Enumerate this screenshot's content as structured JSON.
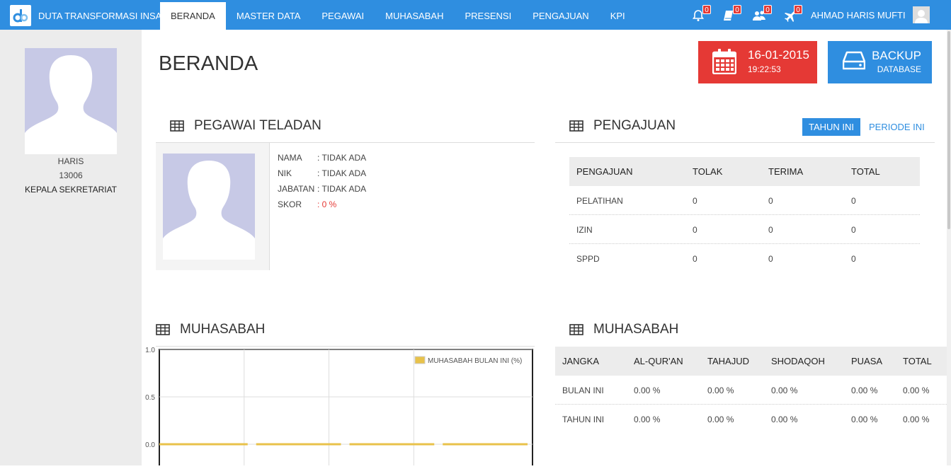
{
  "app": {
    "brand": "DUTA TRANSFORMASI INSANI"
  },
  "nav": {
    "items": [
      "BERANDA",
      "MASTER DATA",
      "PEGAWAI",
      "MUHASABAH",
      "PRESENSI",
      "PENGAJUAN",
      "KPI"
    ],
    "active": "BERANDA"
  },
  "notifications": [
    {
      "icon": "bell-icon",
      "count": "0"
    },
    {
      "icon": "book-icon",
      "count": "0"
    },
    {
      "icon": "users-icon",
      "count": "0"
    },
    {
      "icon": "plane-icon",
      "count": "0"
    }
  ],
  "user": {
    "name": "AHMAD HARIS MUFTI"
  },
  "sidebar": {
    "name": "HARIS",
    "nik": "13006",
    "role": "KEPALA SEKRETARIAT"
  },
  "page": {
    "title": "BERANDA"
  },
  "datetime": {
    "date": "16-01-2015",
    "time": "19:22:53"
  },
  "backup": {
    "title": "BACKUP",
    "subtitle": "DATABASE"
  },
  "teladan": {
    "title": "PEGAWAI TELADAN",
    "fields": [
      {
        "label": "NAMA",
        "value": ": TIDAK ADA"
      },
      {
        "label": "NIK",
        "value": ": TIDAK ADA"
      },
      {
        "label": "JABATAN",
        "value": ": TIDAK ADA"
      },
      {
        "label": "SKOR",
        "value": ": 0 %"
      }
    ],
    "score_color": "#e53935"
  },
  "pengajuan": {
    "title": "PENGAJUAN",
    "tabs": [
      "TAHUN INI",
      "PERIODE INI"
    ],
    "active_tab": "TAHUN INI",
    "columns": [
      "PENGAJUAN",
      "TOLAK",
      "TERIMA",
      "TOTAL"
    ],
    "rows": [
      [
        "PELATIHAN",
        "0",
        "0",
        "0"
      ],
      [
        "IZIN",
        "0",
        "0",
        "0"
      ],
      [
        "SPPD",
        "0",
        "0",
        "0"
      ]
    ]
  },
  "muhasabah_chart": {
    "title": "MUHASABAH"
  },
  "chart_data": {
    "type": "line",
    "title": "",
    "xlabel": "",
    "ylabel": "",
    "ylim": [
      0,
      1.0
    ],
    "yticks": [
      "1.0",
      "0.5",
      "0.0"
    ],
    "series": [
      {
        "name": "MUHASABAH BULAN INI (%)",
        "values": [
          0,
          0,
          0,
          0
        ]
      }
    ],
    "legend": "top-right",
    "color": "#e8c24a",
    "grid": true
  },
  "muhasabah_table": {
    "title": "MUHASABAH",
    "columns": [
      "JANGKA",
      "AL-QUR'AN",
      "TAHAJUD",
      "SHODAQOH",
      "PUASA",
      "TOTAL"
    ],
    "rows": [
      [
        "BULAN INI",
        "0.00 %",
        "0.00 %",
        "0.00 %",
        "0.00 %",
        "0.00 %"
      ],
      [
        "TAHUN INI",
        "0.00 %",
        "0.00 %",
        "0.00 %",
        "0.00 %",
        "0.00 %"
      ]
    ]
  },
  "colors": {
    "primary": "#2f8ee0",
    "danger": "#e53935",
    "sidebar": "#ececec",
    "photo": "#c7c9e6"
  }
}
